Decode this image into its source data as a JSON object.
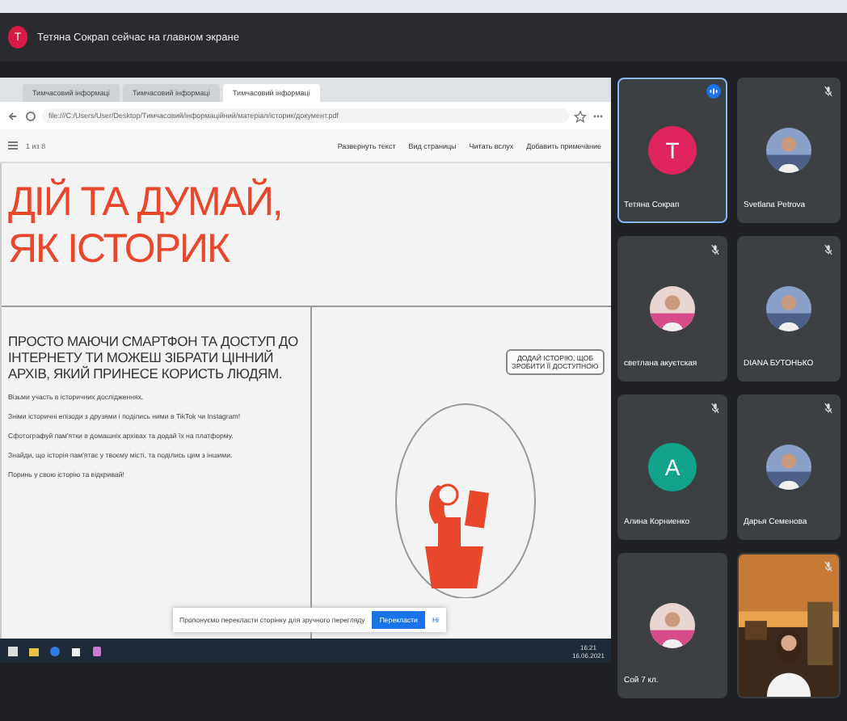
{
  "banner": {
    "avatar_letter": "T",
    "text": "Тетяна Сокрап сейчас на главном экране"
  },
  "browser": {
    "tabs": [
      {
        "label": "Тимчасовий інформаці",
        "selected": false
      },
      {
        "label": "Тимчасовий інформаці",
        "selected": false
      },
      {
        "label": "Тимчасовий інформаці",
        "selected": true
      }
    ],
    "address": "file:///C:/Users/User/Desktop/Тимчасовий/інформаційний/матеріал/історик/документ.pdf",
    "page_counter": "1 из 8",
    "toolbar_buttons": [
      "Развернуть текст",
      "Вид страницы",
      "Читать вслух",
      "Добавить примечание"
    ]
  },
  "page": {
    "heading_lines": [
      "ДІЙ ТА ДУМАЙ,",
      "ЯК ІСТОРИК"
    ],
    "lead": "ПРОСТО МАЮЧИ СМАРТФОН ТА ДОСТУП ДО ІНТЕРНЕТУ ТИ МОЖЕШ ЗІБРАТИ ЦІННИЙ АРХІВ, ЯКИЙ ПРИНЕСЕ КОРИСТЬ ЛЮДЯМ.",
    "bullets": [
      "Візьми участь в історичних дослідженнях.",
      "Зніми історичні епізоди з друзями і поділись ними в TikTok чи Instagram!",
      "Сфотографуй пам'ятки в домашніх архівах та додай їх на платформу.",
      "Знайди, що історія пам'ятає у твоєму місті, та поділись цим з іншими.",
      "Поринь у свою історію та відкривай!"
    ],
    "bubble": "ДОДАЙ ІСТОРІЮ, ЩОБ ЗРОБИТИ ЇЇ ДОСТУПНОЮ"
  },
  "notice": {
    "text": "Пропонуємо перекласти сторінку для зручного перегляду",
    "button": "Перекласти",
    "link": "Ні"
  },
  "taskbar": {
    "time": "16:21",
    "date": "16.06.2021"
  },
  "participants": [
    {
      "name": "Тетяна Сокрап",
      "kind": "letter",
      "letter": "T",
      "color": "#e0245e",
      "selected": true,
      "muted": false
    },
    {
      "name": "Svetlana Petrova",
      "selected": false,
      "muted": true
    },
    {
      "name": "светлана акуєтская",
      "selected": false,
      "muted": true
    },
    {
      "name": "DIANA БУТОНЬКО",
      "selected": false,
      "muted": true
    },
    {
      "name": "Алина Корниенко",
      "kind": "letter",
      "letter": "A",
      "color": "#12a38a",
      "selected": false,
      "muted": true
    },
    {
      "name": "Дарья Семенова",
      "selected": false,
      "muted": true
    },
    {
      "name": "Сой 7 кл.",
      "selected": false,
      "muted": false
    },
    {
      "kind": "video",
      "selected": false,
      "muted": true
    }
  ]
}
